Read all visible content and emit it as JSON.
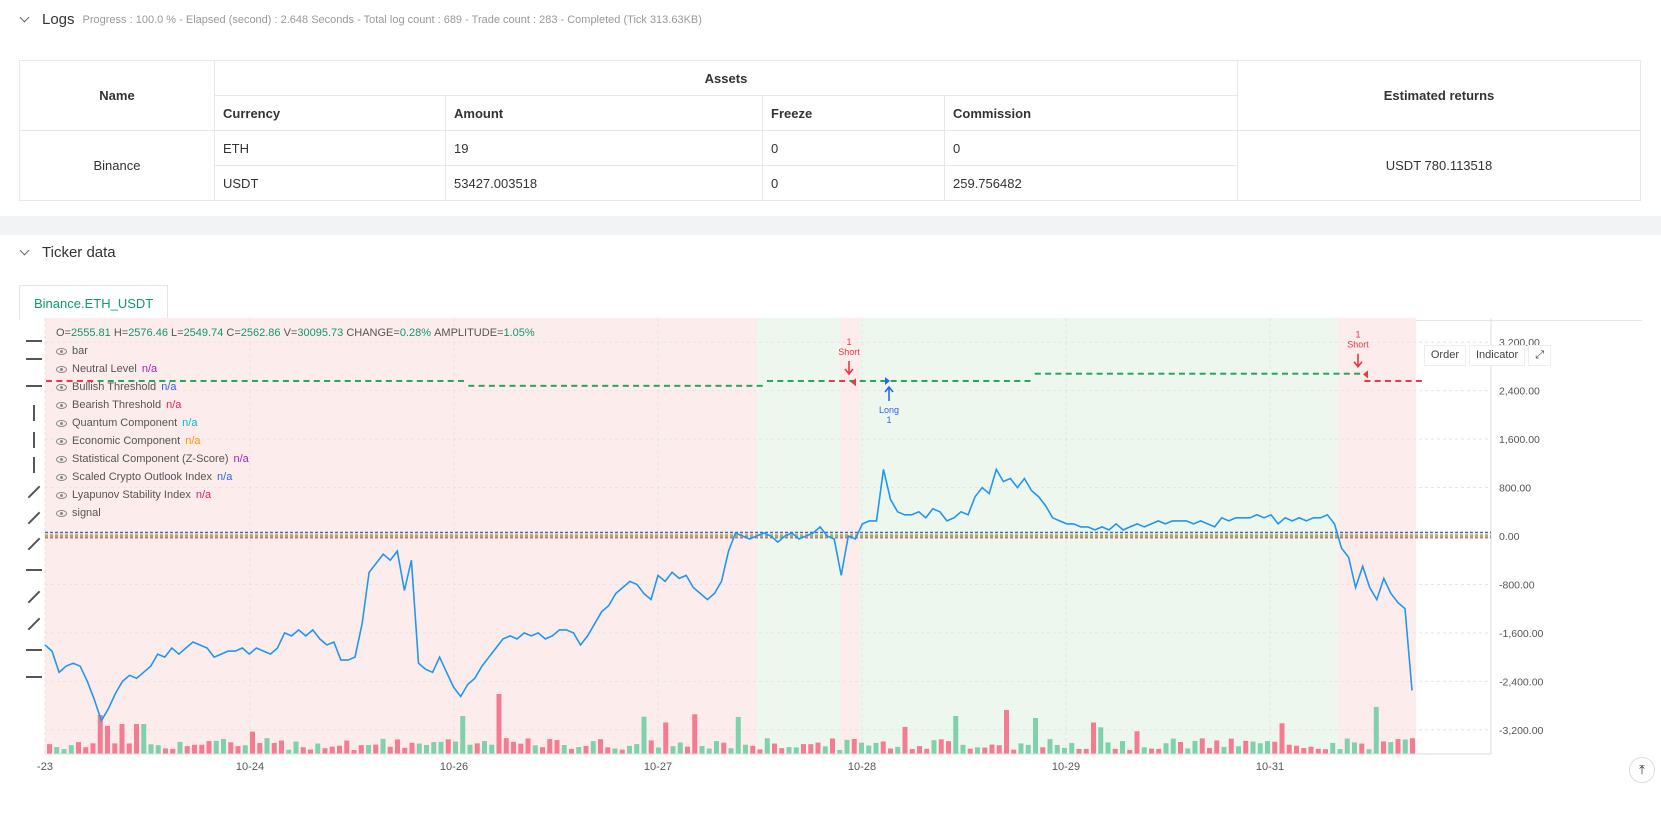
{
  "logs": {
    "title": "Logs",
    "meta": "Progress : 100.0 % - Elapsed (second) : 2.648 Seconds - Total log count : 689 - Trade count : 283 - Completed (Tick 313.63KB)"
  },
  "assets_table": {
    "header_name": "Name",
    "header_assets": "Assets",
    "header_returns": "Estimated returns",
    "sub_headers": [
      "Currency",
      "Amount",
      "Freeze",
      "Commission"
    ],
    "exchange": "Binance",
    "rows": [
      {
        "currency": "ETH",
        "amount": "19",
        "freeze": "0",
        "commission": "0"
      },
      {
        "currency": "USDT",
        "amount": "53427.003518",
        "freeze": "0",
        "commission": "259.756482"
      }
    ],
    "estimated_returns": "USDT 780.113518"
  },
  "ticker": {
    "title": "Ticker data",
    "tab": "Binance.ETH_USDT"
  },
  "chart": {
    "ohlc": {
      "o_label": "O=",
      "o": "2555.81",
      "h_label": "H=",
      "h": "2576.46",
      "l_label": "L=",
      "l": "2549.74",
      "c_label": "C=",
      "c": "2562.86",
      "v_label": "V=",
      "v": "30095.73",
      "change_label": "CHANGE=",
      "change": "0.28%",
      "amp_label": "AMPLITUDE=",
      "amp": "1.05%"
    },
    "legend": [
      {
        "name": "bar",
        "value": "",
        "color": "#555555"
      },
      {
        "name": "Neutral Level",
        "value": "n/a",
        "color": "#9c27b0"
      },
      {
        "name": "Bullish Threshold",
        "value": "n/a",
        "color": "#2962ff"
      },
      {
        "name": "Bearish Threshold",
        "value": "n/a",
        "color": "#e91e63"
      },
      {
        "name": "Quantum Component",
        "value": "n/a",
        "color": "#00bcd4"
      },
      {
        "name": "Economic Component",
        "value": "n/a",
        "color": "#ff9800"
      },
      {
        "name": "Statistical Component (Z-Score)",
        "value": "n/a",
        "color": "#9c27b0"
      },
      {
        "name": "Scaled Crypto Outlook Index",
        "value": "n/a",
        "color": "#2962ff"
      },
      {
        "name": "Lyapunov Stability Index",
        "value": "n/a",
        "color": "#e91e63"
      },
      {
        "name": "signal",
        "value": "",
        "color": "#555555"
      }
    ],
    "buttons": {
      "order": "Order",
      "indicator": "Indicator"
    },
    "y_ticks": [
      "3,200.00",
      "2,400.00",
      "1,600.00",
      "800.00",
      "0.00",
      "-800.00",
      "-1,600.00",
      "-2,400.00",
      "-3,200.00"
    ],
    "x_ticks": [
      "-23",
      "10-24",
      "10-26",
      "10-27",
      "10-28",
      "10-29",
      "10-31"
    ],
    "annotations": [
      {
        "type": "short",
        "qty": "1",
        "label": "Short"
      },
      {
        "type": "long",
        "qty": "1",
        "label": "Long"
      },
      {
        "type": "short",
        "qty": "1",
        "label": "Short"
      }
    ],
    "colors": {
      "up": "#26a69a",
      "down": "#ef5350",
      "index_line": "#2196f3",
      "bear_bg": "#fdecec",
      "bull_bg": "#eef7ee"
    }
  },
  "chart_data": {
    "type": "line",
    "y_range": [
      -3600,
      3600
    ],
    "series": [
      {
        "name": "Scaled Crypto Outlook Index",
        "values": [
          -1800,
          -1900,
          -2250,
          -2150,
          -2100,
          -2150,
          -2400,
          -2700,
          -3050,
          -2850,
          -2600,
          -2400,
          -2300,
          -2350,
          -2250,
          -2150,
          -1950,
          -2000,
          -1850,
          -1950,
          -1850,
          -1750,
          -1800,
          -1850,
          -2000,
          -1950,
          -1900,
          -1900,
          -1850,
          -1950,
          -1850,
          -1900,
          -1950,
          -1850,
          -1600,
          -1650,
          -1550,
          -1650,
          -1550,
          -1700,
          -1800,
          -1750,
          -2050,
          -2050,
          -2000,
          -1450,
          -600,
          -450,
          -300,
          -400,
          -250,
          -900,
          -400,
          -2100,
          -2200,
          -2250,
          -2000,
          -2250,
          -2500,
          -2650,
          -2450,
          -2350,
          -2150,
          -2000,
          -1850,
          -1700,
          -1650,
          -1700,
          -1600,
          -1650,
          -1600,
          -1700,
          -1650,
          -1550,
          -1550,
          -1600,
          -1800,
          -1650,
          -1450,
          -1250,
          -1150,
          -950,
          -850,
          -750,
          -800,
          -950,
          -1050,
          -650,
          -750,
          -600,
          -700,
          -650,
          -850,
          -950,
          -1050,
          -950,
          -750,
          -250,
          50,
          0,
          -50,
          0,
          50,
          0,
          -100,
          0,
          50,
          -50,
          0,
          50,
          150,
          0,
          -50,
          -650,
          0,
          -50,
          200,
          250,
          250,
          1100,
          600,
          400,
          350,
          350,
          400,
          300,
          450,
          400,
          250,
          300,
          400,
          350,
          650,
          800,
          700,
          1100,
          900,
          950,
          800,
          950,
          750,
          650,
          500,
          300,
          250,
          200,
          200,
          150,
          150,
          100,
          150,
          100,
          200,
          100,
          150,
          200,
          150,
          200,
          250,
          200,
          250,
          250,
          250,
          200,
          250,
          200,
          150,
          300,
          250,
          300,
          300,
          300,
          350,
          300,
          350,
          200,
          300,
          250,
          300,
          250,
          300,
          300,
          350,
          200,
          -200,
          -350,
          -850,
          -500,
          -850,
          -1050,
          -700,
          -950,
          -1100,
          -1200,
          -2550
        ]
      }
    ]
  }
}
